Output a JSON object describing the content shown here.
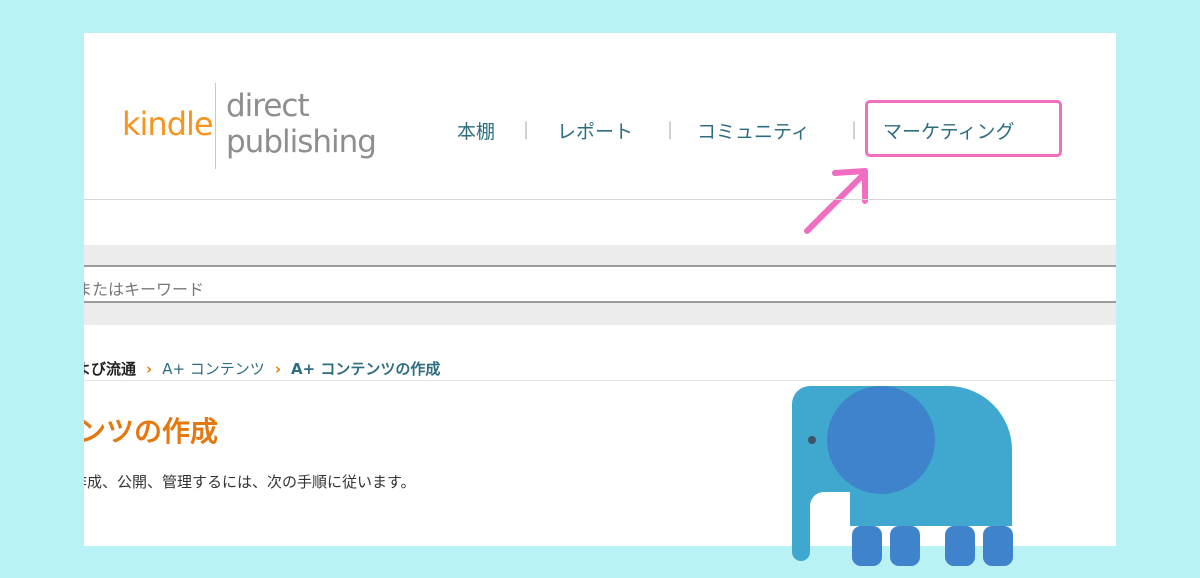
{
  "logo": {
    "word1": "kindle",
    "word2": "direct",
    "word3": "publishing"
  },
  "nav": {
    "items": [
      "本棚",
      "レポート",
      "コミュニティ",
      "マーケティング"
    ],
    "separator": "|"
  },
  "search": {
    "placeholder_partial": "またはキーワード"
  },
  "breadcrumb": {
    "items": [
      "よび流通",
      "A+ コンテンツ",
      "A+ コンテンツの作成"
    ],
    "separator": "›"
  },
  "page": {
    "title_partial": "ンツの作成",
    "description_partial": "作成、公開、管理するには、次の手順に従います。"
  },
  "colors": {
    "background": "#b9f2f5",
    "kindle_orange": "#f7941d",
    "nav_teal": "#2e6d80",
    "title_orange": "#e47911",
    "highlight_pink": "#f06dc2",
    "elephant_blue": "#40a8cf",
    "elephant_dark_blue": "#3f83cc"
  }
}
